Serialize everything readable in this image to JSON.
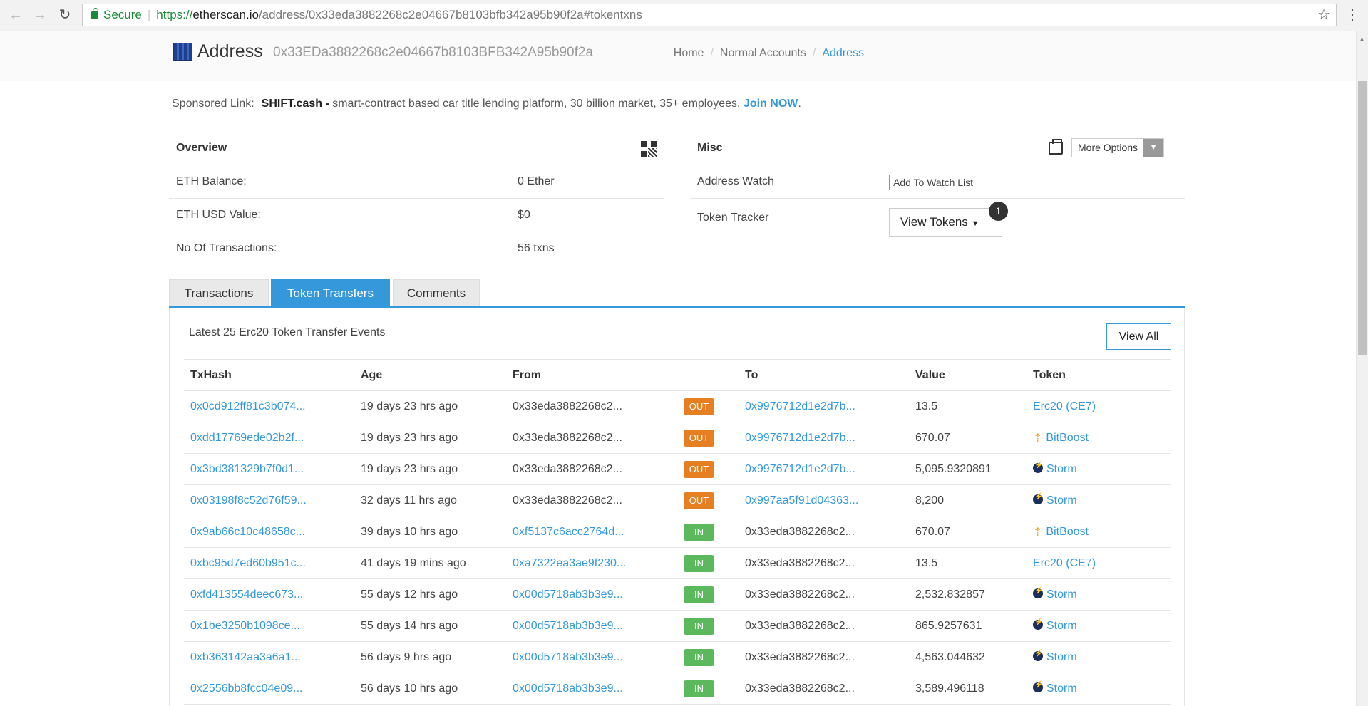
{
  "browser": {
    "secure_label": "Secure",
    "url_scheme": "https://",
    "url_host": "etherscan.io",
    "url_path": "/address/0x33eda3882268c2e04667b8103bfb342a95b90f2a#tokentxns"
  },
  "header": {
    "title": "Address",
    "hash": "0x33EDa3882268c2e04667b8103BFB342A95b90f2a",
    "breadcrumb": [
      "Home",
      "Normal Accounts",
      "Address"
    ]
  },
  "sponsored": {
    "label": "Sponsored Link:",
    "name": "SHIFT.cash -",
    "text": " smart-contract based car title lending platform, 30 billion market, 35+ employees. ",
    "link": "Join NOW",
    "suffix": "."
  },
  "overview": {
    "title": "Overview",
    "rows": [
      {
        "label": "ETH Balance:",
        "value": "0 Ether"
      },
      {
        "label": "ETH USD Value:",
        "value": "$0"
      },
      {
        "label": "No Of Transactions:",
        "value": "56 txns"
      }
    ]
  },
  "misc": {
    "title": "Misc",
    "more_options": "More Options",
    "address_watch_label": "Address Watch",
    "watch_button": "Add To Watch List",
    "token_tracker_label": "Token Tracker",
    "view_tokens": "View Tokens",
    "token_count": "1"
  },
  "tabs": [
    "Transactions",
    "Token Transfers",
    "Comments"
  ],
  "transfers": {
    "caption": "Latest 25 Erc20 Token Transfer Events",
    "view_all": "View All",
    "columns": [
      "TxHash",
      "Age",
      "From",
      "",
      "To",
      "Value",
      "Token"
    ],
    "rows": [
      {
        "hash": "0x0cd912ff81c3b074...",
        "age": "19 days 23 hrs ago",
        "from": "0x33eda3882268c2...",
        "dir": "OUT",
        "to": "0x9976712d1e2d7b...",
        "value": "13.5",
        "token": "Erc20 (CE7)",
        "icon": "none"
      },
      {
        "hash": "0xdd17769ede02b2f...",
        "age": "19 days 23 hrs ago",
        "from": "0x33eda3882268c2...",
        "dir": "OUT",
        "to": "0x9976712d1e2d7b...",
        "value": "670.07",
        "token": "BitBoost",
        "icon": "boost"
      },
      {
        "hash": "0x3bd381329b7f0d1...",
        "age": "19 days 23 hrs ago",
        "from": "0x33eda3882268c2...",
        "dir": "OUT",
        "to": "0x9976712d1e2d7b...",
        "value": "5,095.9320891",
        "token": "Storm",
        "icon": "storm"
      },
      {
        "hash": "0x03198f8c52d76f59...",
        "age": "32 days 11 hrs ago",
        "from": "0x33eda3882268c2...",
        "dir": "OUT",
        "to": "0x997aa5f91d04363...",
        "value": "8,200",
        "token": "Storm",
        "icon": "storm"
      },
      {
        "hash": "0x9ab66c10c48658c...",
        "age": "39 days 10 hrs ago",
        "from": "0xf5137c6acc2764d...",
        "dir": "IN",
        "to": "0x33eda3882268c2...",
        "value": "670.07",
        "token": "BitBoost",
        "icon": "boost"
      },
      {
        "hash": "0xbc95d7ed60b951c...",
        "age": "41 days 19 mins ago",
        "from": "0xa7322ea3ae9f230...",
        "dir": "IN",
        "to": "0x33eda3882268c2...",
        "value": "13.5",
        "token": "Erc20 (CE7)",
        "icon": "none"
      },
      {
        "hash": "0xfd413554deec673...",
        "age": "55 days 12 hrs ago",
        "from": "0x00d5718ab3b3e9...",
        "dir": "IN",
        "to": "0x33eda3882268c2...",
        "value": "2,532.832857",
        "token": "Storm",
        "icon": "storm"
      },
      {
        "hash": "0x1be3250b1098ce...",
        "age": "55 days 14 hrs ago",
        "from": "0x00d5718ab3b3e9...",
        "dir": "IN",
        "to": "0x33eda3882268c2...",
        "value": "865.9257631",
        "token": "Storm",
        "icon": "storm"
      },
      {
        "hash": "0xb363142aa3a6a1...",
        "age": "56 days 9 hrs ago",
        "from": "0x00d5718ab3b3e9...",
        "dir": "IN",
        "to": "0x33eda3882268c2...",
        "value": "4,563.044632",
        "token": "Storm",
        "icon": "storm"
      },
      {
        "hash": "0x2556bb8fcc04e09...",
        "age": "56 days 10 hrs ago",
        "from": "0x00d5718ab3b3e9...",
        "dir": "IN",
        "to": "0x33eda3882268c2...",
        "value": "3,589.496118",
        "token": "Storm",
        "icon": "storm"
      }
    ]
  }
}
